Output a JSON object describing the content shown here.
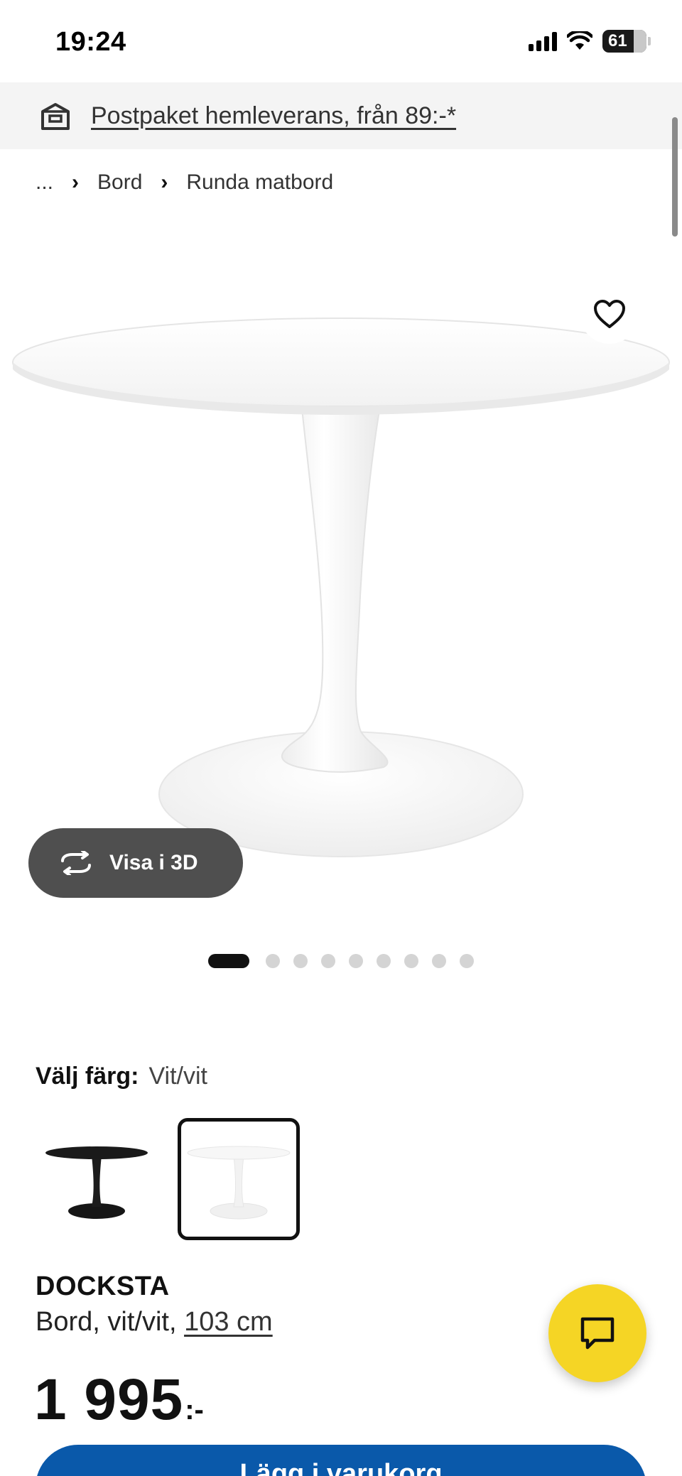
{
  "status_bar": {
    "time": "19:24",
    "battery": "61"
  },
  "banner": {
    "text": "Postpaket hemleverans, från 89:-*",
    "icon": "delivery-box-icon"
  },
  "breadcrumb": {
    "ellipsis": "...",
    "items": [
      "Bord",
      "Runda matbord"
    ]
  },
  "gallery": {
    "view_3d_label": "Visa i 3D",
    "slide_count": 9,
    "active_slide": 1
  },
  "color": {
    "label": "Välj färg:",
    "selected": "Vit/vit",
    "options": [
      "black-table-swatch",
      "white-table-swatch"
    ]
  },
  "product": {
    "name": "DOCKSTA",
    "description": "Bord, vit/vit, ",
    "size": "103 cm",
    "price": "1 995",
    "price_suffix": ":-"
  },
  "cart": {
    "label": "Lägg i varukorg"
  },
  "colors": {
    "accent_blue": "#0a59aa",
    "chat_yellow": "#f5d525",
    "banner_bg": "#f4f4f4"
  }
}
